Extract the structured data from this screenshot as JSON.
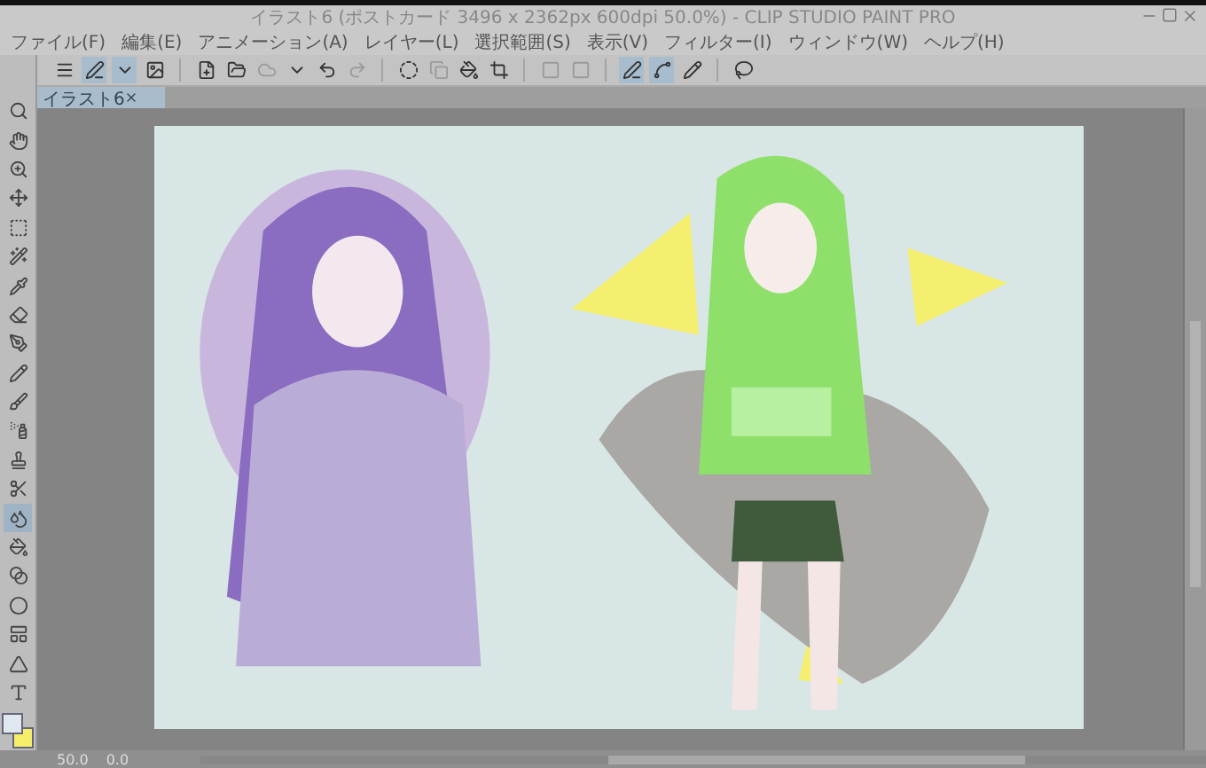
{
  "window": {
    "title": "イラスト6 (ポストカード 3496 x 2362px 600dpi 50.0%) - CLIP STUDIO PAINT PRO"
  },
  "menu": [
    "ファイル(F)",
    "編集(E)",
    "アニメーション(A)",
    "レイヤー(L)",
    "選択範囲(S)",
    "表示(V)",
    "フィルター(I)",
    "ウィンドウ(W)",
    "ヘルプ(H)"
  ],
  "command_bar": [
    {
      "kind": "menu",
      "selected": false,
      "disabled": false
    },
    {
      "kind": "pen",
      "selected": true,
      "disabled": false
    },
    {
      "kind": "caret",
      "selected": true,
      "disabled": false
    },
    {
      "kind": "image",
      "selected": false,
      "disabled": false
    },
    {
      "kind": "sep"
    },
    {
      "kind": "new",
      "selected": false,
      "disabled": false
    },
    {
      "kind": "open",
      "selected": false,
      "disabled": false
    },
    {
      "kind": "cloud",
      "selected": false,
      "disabled": true
    },
    {
      "kind": "caret",
      "selected": false,
      "disabled": false
    },
    {
      "kind": "undo",
      "selected": false,
      "disabled": false
    },
    {
      "kind": "redo",
      "selected": false,
      "disabled": true
    },
    {
      "kind": "sep"
    },
    {
      "kind": "clear",
      "selected": false,
      "disabled": false
    },
    {
      "kind": "copy",
      "selected": false,
      "disabled": true
    },
    {
      "kind": "fill",
      "selected": false,
      "disabled": false
    },
    {
      "kind": "crop",
      "selected": false,
      "disabled": false
    },
    {
      "kind": "sep"
    },
    {
      "kind": "square",
      "selected": false,
      "disabled": true
    },
    {
      "kind": "square",
      "selected": false,
      "disabled": true
    },
    {
      "kind": "sep"
    },
    {
      "kind": "pen",
      "selected": true,
      "disabled": false
    },
    {
      "kind": "line",
      "selected": true,
      "disabled": false
    },
    {
      "kind": "pencil",
      "selected": false,
      "disabled": false
    },
    {
      "kind": "sep"
    },
    {
      "kind": "lasso",
      "selected": false,
      "disabled": false
    }
  ],
  "tab": {
    "label": "イラスト6",
    "selected": true
  },
  "tools": [
    {
      "kind": "search",
      "selected": false
    },
    {
      "kind": "hand",
      "selected": false
    },
    {
      "kind": "zoom",
      "selected": false
    },
    {
      "kind": "move",
      "selected": false
    },
    {
      "kind": "select",
      "selected": false
    },
    {
      "kind": "wand",
      "selected": false
    },
    {
      "kind": "dropper",
      "selected": false
    },
    {
      "kind": "eraser",
      "selected": false
    },
    {
      "kind": "pen",
      "selected": false
    },
    {
      "kind": "pencil",
      "selected": false
    },
    {
      "kind": "brush",
      "selected": false
    },
    {
      "kind": "airbrush",
      "selected": false
    },
    {
      "kind": "stamp",
      "selected": false
    },
    {
      "kind": "scissors",
      "selected": false
    },
    {
      "kind": "blend",
      "selected": true
    },
    {
      "kind": "fill",
      "selected": false
    },
    {
      "kind": "gradient",
      "selected": false
    },
    {
      "kind": "circle",
      "selected": false
    },
    {
      "kind": "frame",
      "selected": false
    },
    {
      "kind": "ruler",
      "selected": false
    },
    {
      "kind": "text",
      "selected": false
    }
  ],
  "status_bar": {
    "zoom": "50.0",
    "angle": "0.0"
  }
}
